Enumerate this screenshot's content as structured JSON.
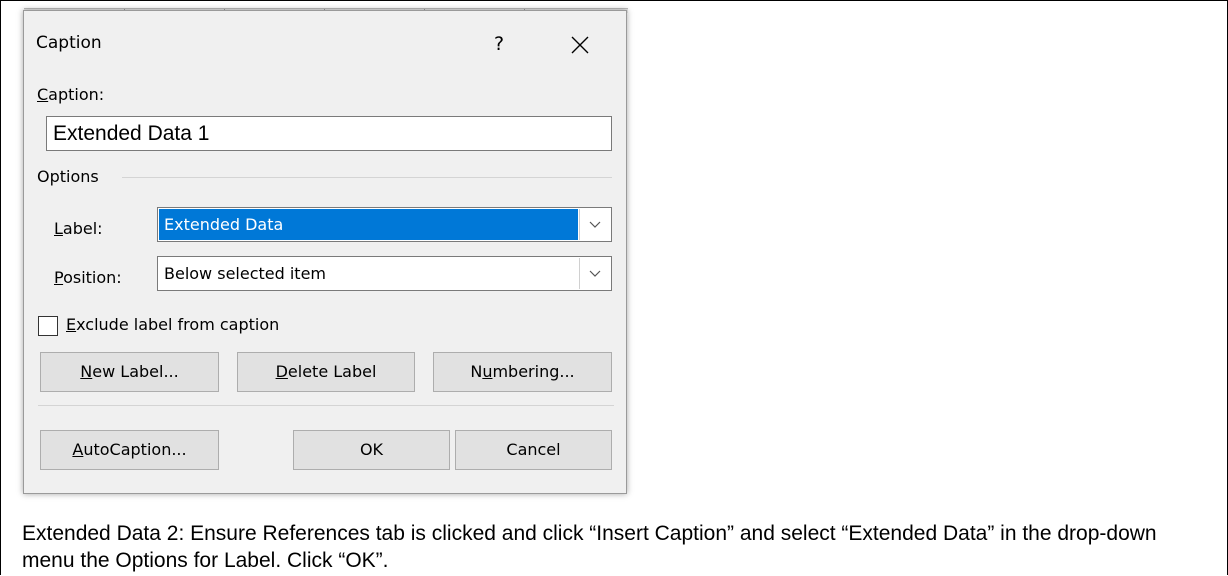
{
  "dialog": {
    "title": "Caption",
    "help_symbol": "?",
    "close_symbol": "×",
    "caption_field_label": "Caption:",
    "caption_field_value": "Extended Data 1",
    "options_group_label": "Options",
    "label_field_label": "Label:",
    "label_selected_value": "Extended Data",
    "position_field_label": "Position:",
    "position_selected_value": "Below selected item",
    "exclude_checkbox_label": "Exclude label from caption",
    "exclude_checked": false,
    "buttons": {
      "new_label": "New Label...",
      "delete_label": "Delete Label",
      "numbering": "Numbering...",
      "autocaption": "AutoCaption...",
      "ok": "OK",
      "cancel": "Cancel"
    },
    "selection_color": "#0078d7"
  },
  "document": {
    "figure_caption": "Extended Data 2: Ensure References tab is clicked and click “Insert Caption” and select “Extended Data” in the drop-down menu the Options for Label. Click “OK”."
  }
}
